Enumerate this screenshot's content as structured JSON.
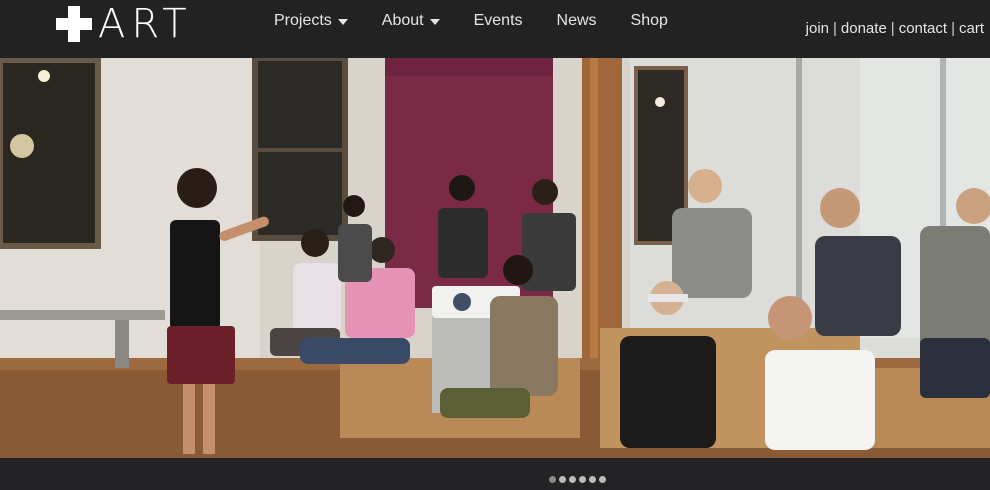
{
  "logo": {
    "text": "ART",
    "icon": "plus-cross-icon"
  },
  "nav": [
    {
      "label": "Projects",
      "dropdown": true
    },
    {
      "label": "About",
      "dropdown": true
    },
    {
      "label": "Events",
      "dropdown": false
    },
    {
      "label": "News",
      "dropdown": false
    },
    {
      "label": "Shop",
      "dropdown": false
    }
  ],
  "utility_links": [
    "join",
    "donate",
    "contact",
    "cart"
  ],
  "utility_separator": "|",
  "carousel": {
    "slide_count": 6,
    "active_index": 0
  },
  "colors": {
    "header_bg": "#222223",
    "accent_wall": "#7a2a45",
    "footer_bg": "#232325"
  }
}
